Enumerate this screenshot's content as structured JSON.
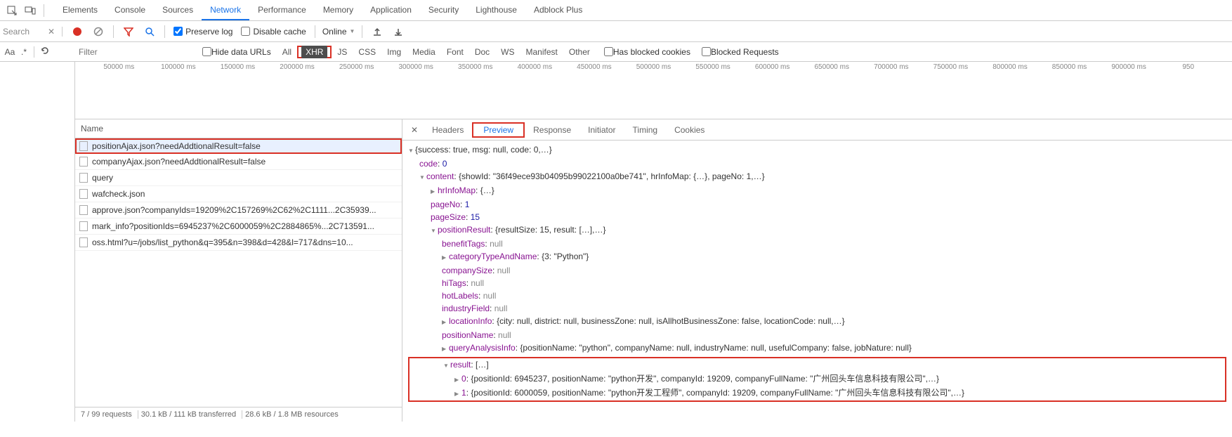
{
  "panels": [
    "Elements",
    "Console",
    "Sources",
    "Network",
    "Performance",
    "Memory",
    "Application",
    "Security",
    "Lighthouse",
    "Adblock Plus"
  ],
  "activePanel": "Network",
  "search": {
    "label": "Search"
  },
  "toolbar": {
    "preserveLog": "Preserve log",
    "disableCache": "Disable cache",
    "throttling": "Online"
  },
  "filterbar": {
    "aa": "Aa",
    "regex": ".*",
    "filterPlaceholder": "Filter",
    "hideDataUrls": "Hide data URLs",
    "types": [
      "All",
      "XHR",
      "JS",
      "CSS",
      "Img",
      "Media",
      "Font",
      "Doc",
      "WS",
      "Manifest",
      "Other"
    ],
    "activeType": "XHR",
    "hasBlockedCookies": "Has blocked cookies",
    "blockedRequests": "Blocked Requests"
  },
  "timelineTicks": [
    "50000 ms",
    "100000 ms",
    "150000 ms",
    "200000 ms",
    "250000 ms",
    "300000 ms",
    "350000 ms",
    "400000 ms",
    "450000 ms",
    "500000 ms",
    "550000 ms",
    "600000 ms",
    "650000 ms",
    "700000 ms",
    "750000 ms",
    "800000 ms",
    "850000 ms",
    "900000 ms",
    "950"
  ],
  "list": {
    "header": "Name",
    "rows": [
      "positionAjax.json?needAddtionalResult=false",
      "companyAjax.json?needAddtionalResult=false",
      "query",
      "wafcheck.json",
      "approve.json?companyIds=19209%2C157269%2C62%2C1111...2C35939...",
      "mark_info?positionIds=6945237%2C6000059%2C2884865%...2C713591...",
      "oss.html?u=/jobs/list_python&q=395&n=398&d=428&l=717&dns=10..."
    ],
    "selectedIndex": 0
  },
  "statusBar": {
    "requests": "7 / 99 requests",
    "transferred": "30.1 kB / 111 kB transferred",
    "resources": "28.6 kB / 1.8 MB resources"
  },
  "detailTabs": [
    "Headers",
    "Preview",
    "Response",
    "Initiator",
    "Timing",
    "Cookies"
  ],
  "activeDetailTab": "Preview",
  "preview": {
    "rootSummary": "{success: true, msg: null, code: 0,…}",
    "code": "0",
    "contentSummary": "{showId: \"36f49ece93b04095b99022100a0be741\", hrInfoMap: {…}, pageNo: 1,…}",
    "hrInfoMap": "{…}",
    "pageNo": "1",
    "pageSize": "15",
    "positionResultSummary": "{resultSize: 15, result: […],…}",
    "benefitTags": "null",
    "categoryTypeAndName": "{3: \"Python\"}",
    "companySize": "null",
    "hiTags": "null",
    "hotLabels": "null",
    "industryField": "null",
    "locationInfo": "{city: null, district: null, businessZone: null, isAllhotBusinessZone: false, locationCode: null,…}",
    "positionName": "null",
    "queryAnalysisInfo": "{positionName: \"python\", companyName: null, industryName: null, usefulCompany: false, jobNature: null}",
    "resultSummary": "[…]",
    "result0": "{positionId: 6945237, positionName: \"python开发\", companyId: 19209, companyFullName: \"广州回头车信息科技有限公司\",…}",
    "result1": "{positionId: 6000059, positionName: \"python开发工程师\", companyId: 19209, companyFullName: \"广州回头车信息科技有限公司\",…}"
  },
  "chart_data": {
    "type": "table",
    "title": "positionResult.result (partial)",
    "columns": [
      "positionId",
      "positionName",
      "companyId",
      "companyFullName"
    ],
    "rows": [
      [
        6945237,
        "python开发",
        19209,
        "广州回头车信息科技有限公司"
      ],
      [
        6000059,
        "python开发工程师",
        19209,
        "广州回头车信息科技有限公司"
      ]
    ]
  }
}
